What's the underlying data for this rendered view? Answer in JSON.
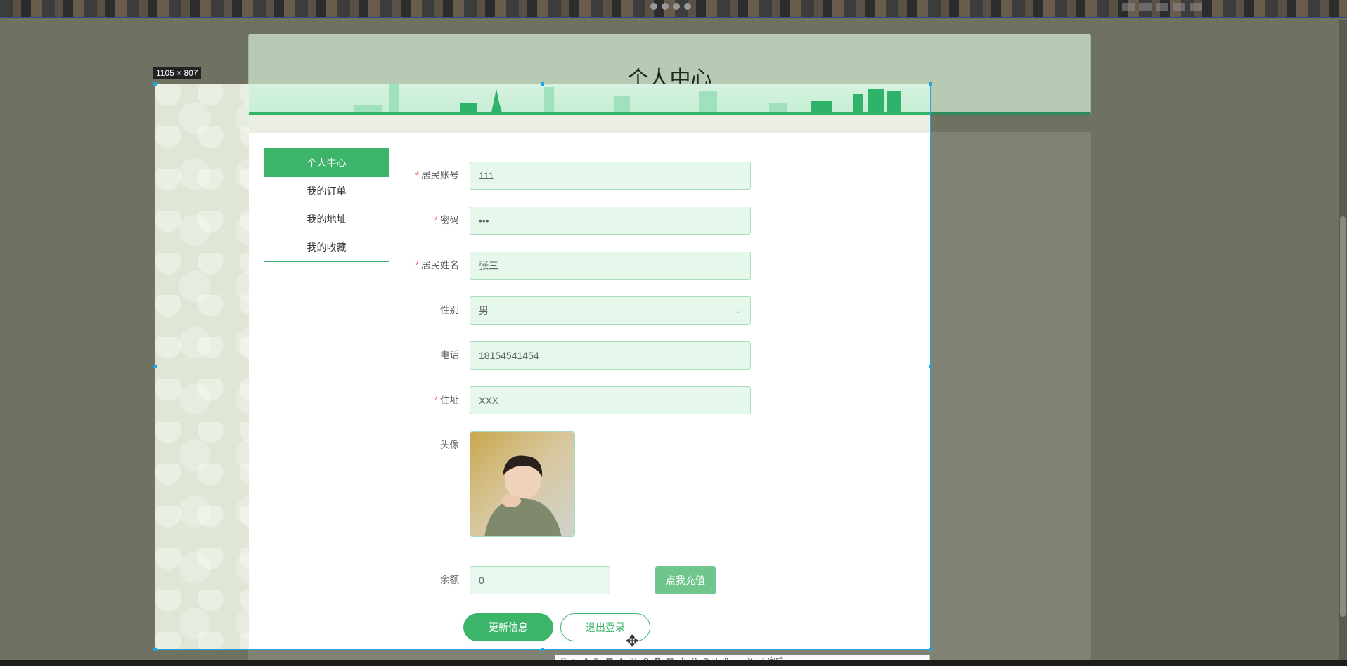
{
  "overlay": {
    "size_label": "1105 × 807"
  },
  "header": {
    "title": "个人中心"
  },
  "side_menu": {
    "items": [
      {
        "label": "个人中心",
        "active": true
      },
      {
        "label": "我的订单",
        "active": false
      },
      {
        "label": "我的地址",
        "active": false
      },
      {
        "label": "我的收藏",
        "active": false
      }
    ]
  },
  "form": {
    "account": {
      "label": "居民账号",
      "value": "111",
      "required": true
    },
    "password": {
      "label": "密码",
      "value": "•••",
      "required": true
    },
    "name": {
      "label": "居民姓名",
      "value": "张三",
      "required": true
    },
    "gender": {
      "label": "性别",
      "value": "男",
      "required": false
    },
    "phone": {
      "label": "电话",
      "value": "18154541454",
      "required": false
    },
    "address": {
      "label": "住址",
      "value": "XXX",
      "required": true
    },
    "avatar": {
      "label": "头像"
    },
    "balance": {
      "label": "余额",
      "value": "0"
    },
    "recharge_button": "点我充值",
    "update_button": "更新信息",
    "logout_button": "退出登录"
  },
  "toolbar": {
    "done_label": "完成"
  },
  "colors": {
    "accent": "#3cb56b",
    "input_bg": "#e6f8ec",
    "selection_border": "#29a3e0"
  }
}
